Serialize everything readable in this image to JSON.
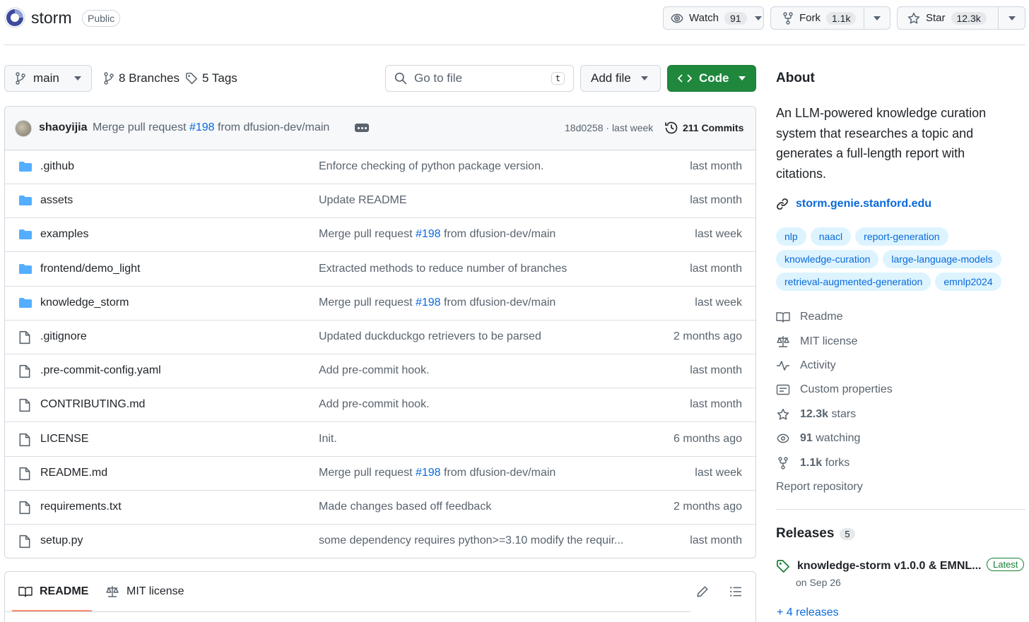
{
  "repo": {
    "name": "storm",
    "visibility": "Public"
  },
  "header": {
    "watch": {
      "label": "Watch",
      "count": "91"
    },
    "fork": {
      "label": "Fork",
      "count": "1.1k"
    },
    "star": {
      "label": "Star",
      "count": "12.3k"
    }
  },
  "toolbar": {
    "branch": "main",
    "branches": "8 Branches",
    "tags": "5 Tags",
    "goto_placeholder": "Go to file",
    "goto_kbd": "t",
    "add_file": "Add file",
    "code": "Code"
  },
  "commit": {
    "author": "shaoyijia",
    "message_prefix": "Merge pull request ",
    "pr": "#198",
    "message_suffix": " from dfusion-dev/main",
    "sha_time": "18d0258 · last week",
    "commits": "211 Commits"
  },
  "files": [
    {
      "name": ".github",
      "type": "dir",
      "msg": "Enforce checking of python package version.",
      "date": "last month"
    },
    {
      "name": "assets",
      "type": "dir",
      "msg": "Update README",
      "date": "last month"
    },
    {
      "name": "examples",
      "type": "dir",
      "msg_prefix": "Merge pull request ",
      "pr": "#198",
      "msg_suffix": " from dfusion-dev/main",
      "date": "last week"
    },
    {
      "name": "frontend/demo_light",
      "type": "dir",
      "msg": "Extracted methods to reduce number of branches",
      "date": "last month"
    },
    {
      "name": "knowledge_storm",
      "type": "dir",
      "msg_prefix": "Merge pull request ",
      "pr": "#198",
      "msg_suffix": " from dfusion-dev/main",
      "date": "last week"
    },
    {
      "name": ".gitignore",
      "type": "file",
      "msg": "Updated duckduckgo retrievers to be parsed",
      "date": "2 months ago"
    },
    {
      "name": ".pre-commit-config.yaml",
      "type": "file",
      "msg": "Add pre-commit hook.",
      "date": "last month"
    },
    {
      "name": "CONTRIBUTING.md",
      "type": "file",
      "msg": "Add pre-commit hook.",
      "date": "last month"
    },
    {
      "name": "LICENSE",
      "type": "file",
      "msg": "Init.",
      "date": "6 months ago"
    },
    {
      "name": "README.md",
      "type": "file",
      "msg_prefix": "Merge pull request ",
      "pr": "#198",
      "msg_suffix": " from dfusion-dev/main",
      "date": "last week"
    },
    {
      "name": "requirements.txt",
      "type": "file",
      "msg": "Made changes based off feedback",
      "date": "2 months ago"
    },
    {
      "name": "setup.py",
      "type": "file",
      "msg": "some dependency requires python>=3.10 modify the requir...",
      "date": "last month"
    }
  ],
  "readme_tabs": {
    "readme": "README",
    "license": "MIT license"
  },
  "about": {
    "title": "About",
    "description": "An LLM-powered knowledge curation system that researches a topic and generates a full-length report with citations.",
    "website": "storm.genie.stanford.edu",
    "topics": [
      "nlp",
      "naacl",
      "report-generation",
      "knowledge-curation",
      "large-language-models",
      "retrieval-augmented-generation",
      "emnlp2024"
    ],
    "readme": "Readme",
    "license": "MIT license",
    "activity": "Activity",
    "custom_properties": "Custom properties",
    "stars_count": "12.3k",
    "stars_label": " stars",
    "watching_count": "91",
    "watching_label": " watching",
    "forks_count": "1.1k",
    "forks_label": " forks",
    "report": "Report repository"
  },
  "releases": {
    "title": "Releases",
    "count": "5",
    "latest_name": "knowledge-storm v1.0.0 & EMNL...",
    "latest_badge": "Latest",
    "latest_date": "on Sep 26",
    "more": "+ 4 releases"
  },
  "colors": {
    "accent": "#0969da",
    "code_button": "#1f883d",
    "folder": "#54aeff",
    "topic_bg": "#ddf4ff"
  }
}
